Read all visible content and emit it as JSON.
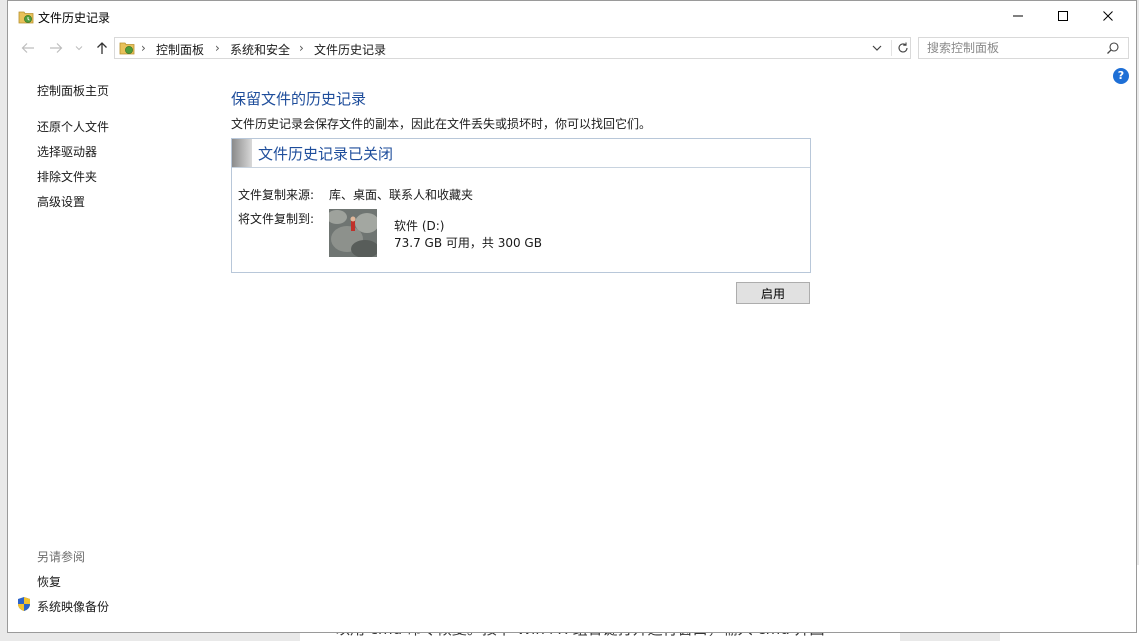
{
  "window": {
    "title": "文件历史记录"
  },
  "address": {
    "breadcrumbs": [
      "控制面板",
      "系统和安全",
      "文件历史记录"
    ]
  },
  "search": {
    "placeholder": "搜索控制面板"
  },
  "help_label": "?",
  "sidebar": {
    "home": "控制面板主页",
    "items": [
      "还原个人文件",
      "选择驱动器",
      "排除文件夹",
      "高级设置"
    ],
    "see_also_heading": "另请参阅",
    "see_also": [
      "恢复",
      "系统映像备份"
    ]
  },
  "main": {
    "title": "保留文件的历史记录",
    "description": "文件历史记录会保存文件的副本，因此在文件丢失或损坏时，你可以找回它们。",
    "status_title": "文件历史记录已关闭",
    "source_label": "文件复制来源:",
    "source_value": "库、桌面、联系人和收藏夹",
    "dest_label": "将文件复制到:",
    "drive_name": "软件 (D:)",
    "drive_space": "73.7 GB 可用，共 300 GB",
    "enable_label": "启用"
  },
  "background": {
    "text": "以用 cmd 命令恢复。按下 Win+R 组合键打开运行窗口，输入 cmd 并回"
  },
  "colors": {
    "link": "#1e4d9b",
    "help": "#1e6fd6"
  }
}
